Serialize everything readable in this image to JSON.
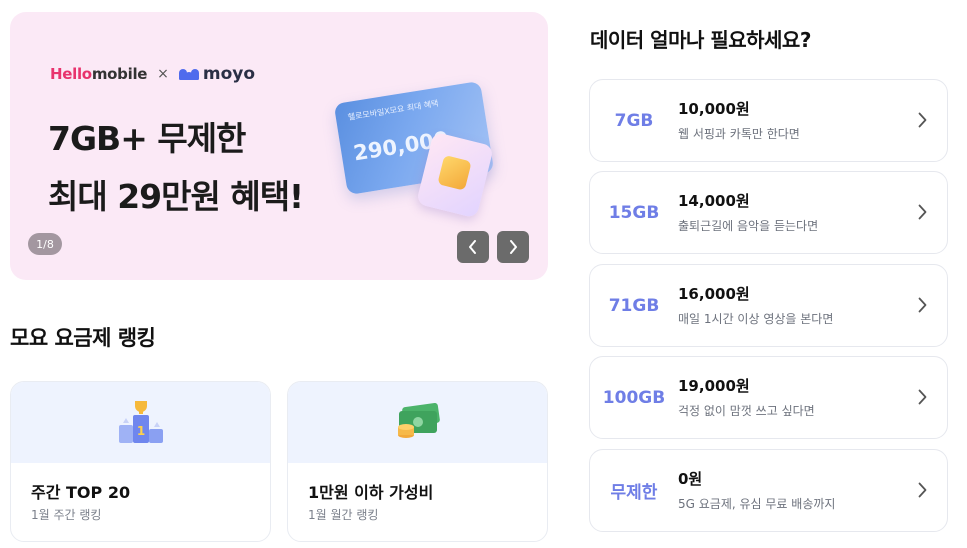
{
  "banner": {
    "brand_hello": "Hello",
    "brand_mobile": "mobile",
    "brand_times": "×",
    "brand_moyo": "moyo",
    "headline_line1": "7GB+ 무제한",
    "headline_line2": "최대 29만원 혜택!",
    "card_caption": "헬로모바일X모요 최대 혜택",
    "card_amount": "290,000",
    "page_indicator": "1/8",
    "background_color": "#fbe9f6"
  },
  "ranking": {
    "title": "모요 요금제 랭킹",
    "cards": [
      {
        "title": "주간 TOP 20",
        "subtitle": "1월 주간 랭킹",
        "icon": "trophy-podium-icon"
      },
      {
        "title": "1만원 이하 가성비",
        "subtitle": "1월 월간 랭킹",
        "icon": "money-coins-icon"
      }
    ]
  },
  "plans_section": {
    "title": "데이터 얼마나 필요하세요?",
    "accent_color": "#6f7ee6",
    "plans": [
      {
        "data": "7GB",
        "price": "10,000원",
        "desc": "웹 서핑과 카톡만 한다면"
      },
      {
        "data": "15GB",
        "price": "14,000원",
        "desc": "출퇴근길에 음악을 듣는다면"
      },
      {
        "data": "71GB",
        "price": "16,000원",
        "desc": "매일 1시간 이상 영상을 본다면"
      },
      {
        "data": "100GB",
        "price": "19,000원",
        "desc": "걱정 없이 맘껏 쓰고 싶다면"
      },
      {
        "data": "무제한",
        "price": "0원",
        "desc": "5G 요금제, 유심 무료 배송까지"
      }
    ]
  }
}
